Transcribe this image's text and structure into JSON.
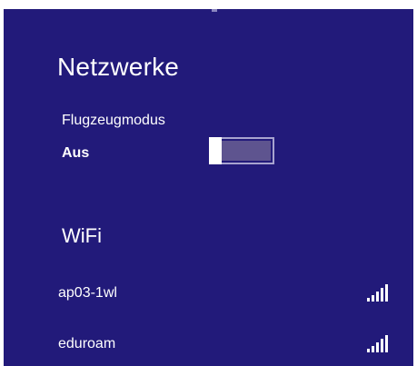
{
  "panel": {
    "title": "Netzwerke",
    "background": "#221a7a"
  },
  "airplane_mode": {
    "label": "Flugzeugmodus",
    "state": "Aus",
    "enabled": false
  },
  "wifi": {
    "section_title": "WiFi",
    "networks": [
      {
        "name": "ap03-1wl",
        "signal_icon": "signal-strength-icon",
        "signal_bars": 5
      },
      {
        "name": "eduroam",
        "signal_icon": "signal-strength-icon",
        "signal_bars": 5
      }
    ]
  }
}
